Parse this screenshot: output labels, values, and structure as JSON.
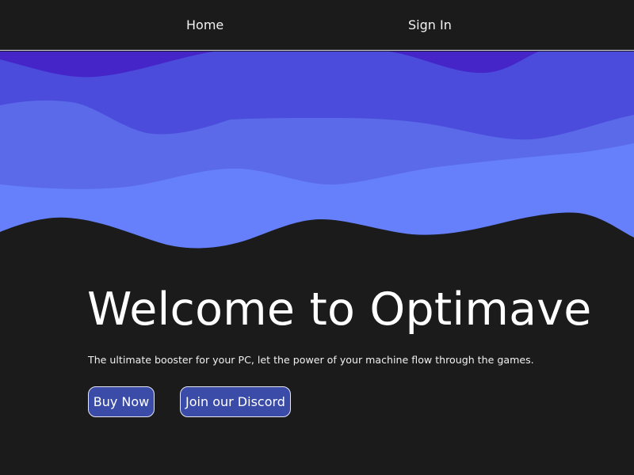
{
  "nav": {
    "home_label": "Home",
    "signin_label": "Sign In"
  },
  "hero": {
    "title": "Welcome to Optimave",
    "subtitle": "The ultimate booster for your PC, let the power of your machine flow through the games.",
    "buy_label": "Buy Now",
    "discord_label": "Join our Discord"
  },
  "colors": {
    "background": "#1b1b1b",
    "wave_top": "#4524c8",
    "wave_2": "#4b4bdc",
    "wave_3": "#5a6ae8",
    "wave_4": "#6680fc",
    "button_fill": "#3a4ba8",
    "button_border": "#e6e6f5"
  }
}
